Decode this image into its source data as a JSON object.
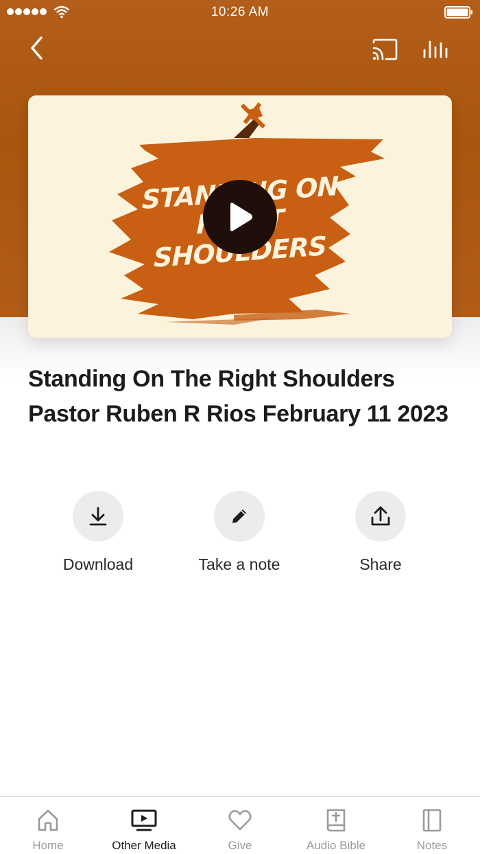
{
  "status_bar": {
    "time": "10:26 AM"
  },
  "colors": {
    "accent": "#b05a15",
    "art_background": "#fbf3dc",
    "art_orange": "#c85f12"
  },
  "icons": {
    "back": "chevron-left-icon",
    "cast": "cast-icon",
    "audio": "audio-bars-icon",
    "play": "play-icon",
    "download": "download-icon",
    "note": "pencil-icon",
    "share": "share-icon"
  },
  "media": {
    "artwork_text": [
      "STANDING ON THE",
      "RIGHT SHOULDERS"
    ],
    "title": "Standing On The Right Shoulders Pastor Ruben R Rios February 11 2023"
  },
  "actions": [
    {
      "label": "Download"
    },
    {
      "label": "Take a note"
    },
    {
      "label": "Share"
    }
  ],
  "tabs": [
    {
      "label": "Home",
      "icon": "home-icon",
      "active": false
    },
    {
      "label": "Other Media",
      "icon": "tv-icon",
      "active": true
    },
    {
      "label": "Give",
      "icon": "heart-icon",
      "active": false
    },
    {
      "label": "Audio Bible",
      "icon": "bible-icon",
      "active": false
    },
    {
      "label": "Notes",
      "icon": "notebook-icon",
      "active": false
    }
  ]
}
